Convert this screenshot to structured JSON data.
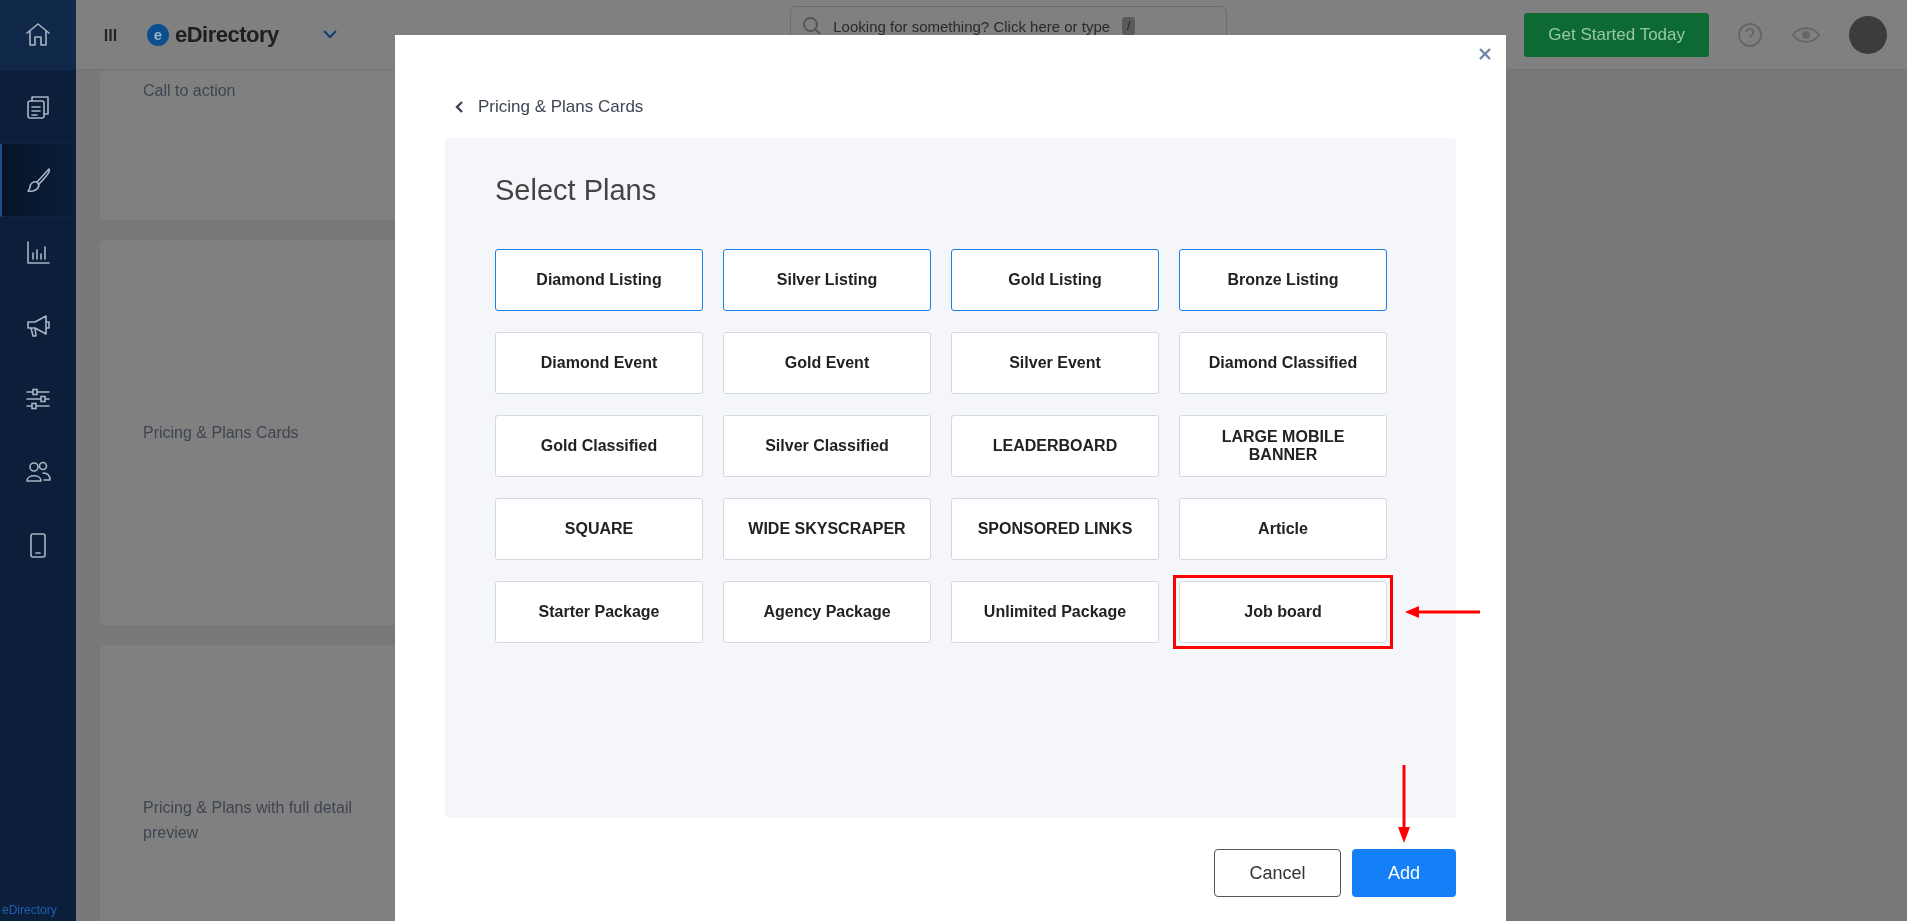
{
  "sidebar": {
    "items": [
      {
        "kind": "home",
        "selected": false
      },
      {
        "kind": "pages",
        "selected": false
      },
      {
        "kind": "brush",
        "selected": true
      },
      {
        "kind": "chart",
        "selected": false
      },
      {
        "kind": "megaphone",
        "selected": false
      },
      {
        "kind": "sliders",
        "selected": false
      },
      {
        "kind": "users",
        "selected": false
      },
      {
        "kind": "mobile",
        "selected": false
      }
    ],
    "footer": "eDirectory"
  },
  "topbar": {
    "logo_letter": "e",
    "brand": "eDirectory",
    "search": {
      "placeholder": "Looking for something? Click here or type",
      "shortcut": "/"
    },
    "cta": "Get Started Today"
  },
  "cards": [
    {
      "title": "Call to action"
    },
    {
      "title": "Pricing & Plans Cards"
    },
    {
      "title": "Pricing & Plans with full detail preview"
    }
  ],
  "modal": {
    "back_link": "Pricing & Plans Cards",
    "heading": "Select Plans",
    "plans": [
      {
        "label": "Diamond Listing",
        "selected": true,
        "annotated": false
      },
      {
        "label": "Silver Listing",
        "selected": true,
        "annotated": false
      },
      {
        "label": "Gold Listing",
        "selected": true,
        "annotated": false
      },
      {
        "label": "Bronze Listing",
        "selected": true,
        "annotated": false
      },
      {
        "label": "Diamond Event",
        "selected": false,
        "annotated": false
      },
      {
        "label": "Gold Event",
        "selected": false,
        "annotated": false
      },
      {
        "label": "Silver Event",
        "selected": false,
        "annotated": false
      },
      {
        "label": "Diamond Classified",
        "selected": false,
        "annotated": false
      },
      {
        "label": "Gold Classified",
        "selected": false,
        "annotated": false
      },
      {
        "label": "Silver Classified",
        "selected": false,
        "annotated": false
      },
      {
        "label": "LEADERBOARD",
        "selected": false,
        "annotated": false
      },
      {
        "label": "LARGE MOBILE BANNER",
        "selected": false,
        "annotated": false
      },
      {
        "label": "SQUARE",
        "selected": false,
        "annotated": false
      },
      {
        "label": "WIDE SKYSCRAPER",
        "selected": false,
        "annotated": false
      },
      {
        "label": "SPONSORED LINKS",
        "selected": false,
        "annotated": false
      },
      {
        "label": "Article",
        "selected": false,
        "annotated": false
      },
      {
        "label": "Starter Package",
        "selected": false,
        "annotated": false
      },
      {
        "label": "Agency Package",
        "selected": false,
        "annotated": false
      },
      {
        "label": "Unlimited Package",
        "selected": false,
        "annotated": false
      },
      {
        "label": "Job board",
        "selected": false,
        "annotated": true
      }
    ],
    "buttons": [
      {
        "kind": "secondary",
        "label": "Cancel",
        "annotated": false
      },
      {
        "kind": "primary",
        "label": "Add",
        "annotated": true
      }
    ]
  }
}
